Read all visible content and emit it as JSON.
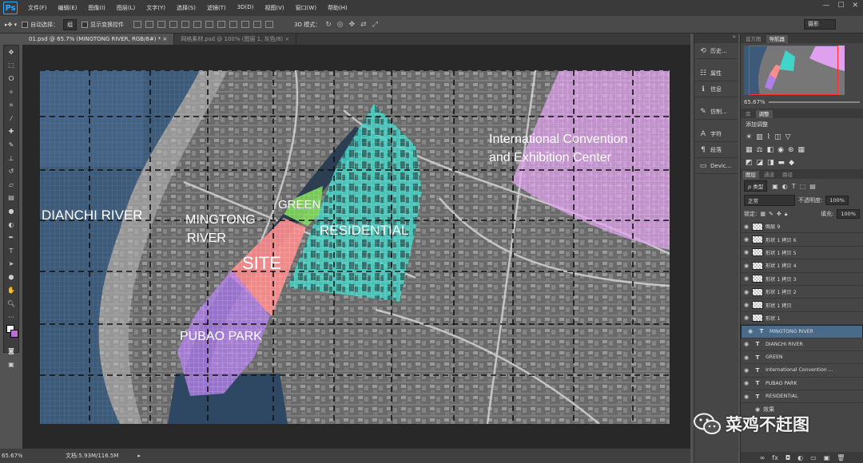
{
  "app": {
    "logo": "Ps"
  },
  "menu": [
    "文件(F)",
    "编辑(E)",
    "图像(I)",
    "图层(L)",
    "文字(Y)",
    "选择(S)",
    "滤镜(T)",
    "3D(D)",
    "视图(V)",
    "窗口(W)",
    "帮助(H)"
  ],
  "options": {
    "auto_select": "自动选择：",
    "group_value": "组",
    "show_transform": "显示变换控件",
    "mode3d": "3D 模式：",
    "workspace": "摄影"
  },
  "tabs": [
    {
      "label": "01.psd @ 65.7% (MINGTONG RIVER, RGB/8#) *",
      "active": true
    },
    {
      "label": "网格素材.psd @ 100% (图层 1, 灰色/8)",
      "active": false
    }
  ],
  "map_labels": {
    "dianchi": "DIANCHI RIVER",
    "mingtong1": "MINGTONG",
    "mingtong2": "RIVER",
    "green": "GREEN",
    "site": "SITE",
    "residential": "RESIDENTIAL",
    "pubao": "PUBAO PARK",
    "convention1": "International Convention",
    "convention2": "and Exhibition Center"
  },
  "status": {
    "zoom": "65.67%",
    "doc": "文档:5.93M/116.5M"
  },
  "dock": [
    {
      "icon": "history-icon",
      "glyph": "⟲",
      "label": "历史..."
    },
    {
      "icon": "properties-icon",
      "glyph": "☷",
      "label": "属性"
    },
    {
      "icon": "info-icon",
      "glyph": "ℹ",
      "label": "信息"
    },
    {
      "icon": "brush-preset-icon",
      "glyph": "✎",
      "label": "仿制..."
    },
    {
      "icon": "character-icon",
      "glyph": "A",
      "label": "字符"
    },
    {
      "icon": "paragraph-icon",
      "glyph": "¶",
      "label": "段落"
    },
    {
      "icon": "device-icon",
      "glyph": "▭",
      "label": "Devic..."
    }
  ],
  "navigator": {
    "tabs": [
      "直方图",
      "导航器"
    ],
    "zoom": "65.67%"
  },
  "adjustments": {
    "tabs": [
      "库",
      "调整"
    ],
    "title": "添加调整"
  },
  "layers_panel": {
    "tabs": [
      "图层",
      "通道",
      "路径"
    ],
    "filter": "ρ 类型",
    "blend": "正常",
    "opacity_label": "不透明度:",
    "opacity": "100%",
    "lock_label": "锁定:",
    "fill_label": "填充:",
    "fill": "100%",
    "layers": [
      {
        "name": "图层 9",
        "kind": "pixel",
        "selected": false
      },
      {
        "name": "形状 1 拷贝 6",
        "kind": "pixel",
        "selected": false
      },
      {
        "name": "形状 1 拷贝 5",
        "kind": "pixel",
        "selected": false
      },
      {
        "name": "形状 1 拷贝 4",
        "kind": "pixel",
        "selected": false
      },
      {
        "name": "形状 1 拷贝 3",
        "kind": "pixel",
        "selected": false
      },
      {
        "name": "形状 1 拷贝 2",
        "kind": "pixel",
        "selected": false
      },
      {
        "name": "形状 1 拷贝",
        "kind": "pixel",
        "selected": false
      },
      {
        "name": "形状 1",
        "kind": "pixel",
        "selected": false
      },
      {
        "name": "MINGTONG RIVER",
        "kind": "text",
        "selected": true
      },
      {
        "name": "DIANCHI RIVER",
        "kind": "text",
        "selected": false
      },
      {
        "name": "GREEN",
        "kind": "text",
        "selected": false
      },
      {
        "name": "International Convention ...",
        "kind": "text",
        "selected": false
      },
      {
        "name": "PUBAO PARK",
        "kind": "text",
        "selected": false
      },
      {
        "name": "RESIDENTIAL",
        "kind": "text",
        "selected": false
      }
    ],
    "effects_label": "效果"
  },
  "watermark": "菜鸡不赶图",
  "colors": {
    "site": "#ff8c8c",
    "residential": "#3fd6c8",
    "park": "#b07ee8",
    "convention": "#e0a0f0",
    "green": "#7ed957",
    "water": "#3d5a78"
  }
}
